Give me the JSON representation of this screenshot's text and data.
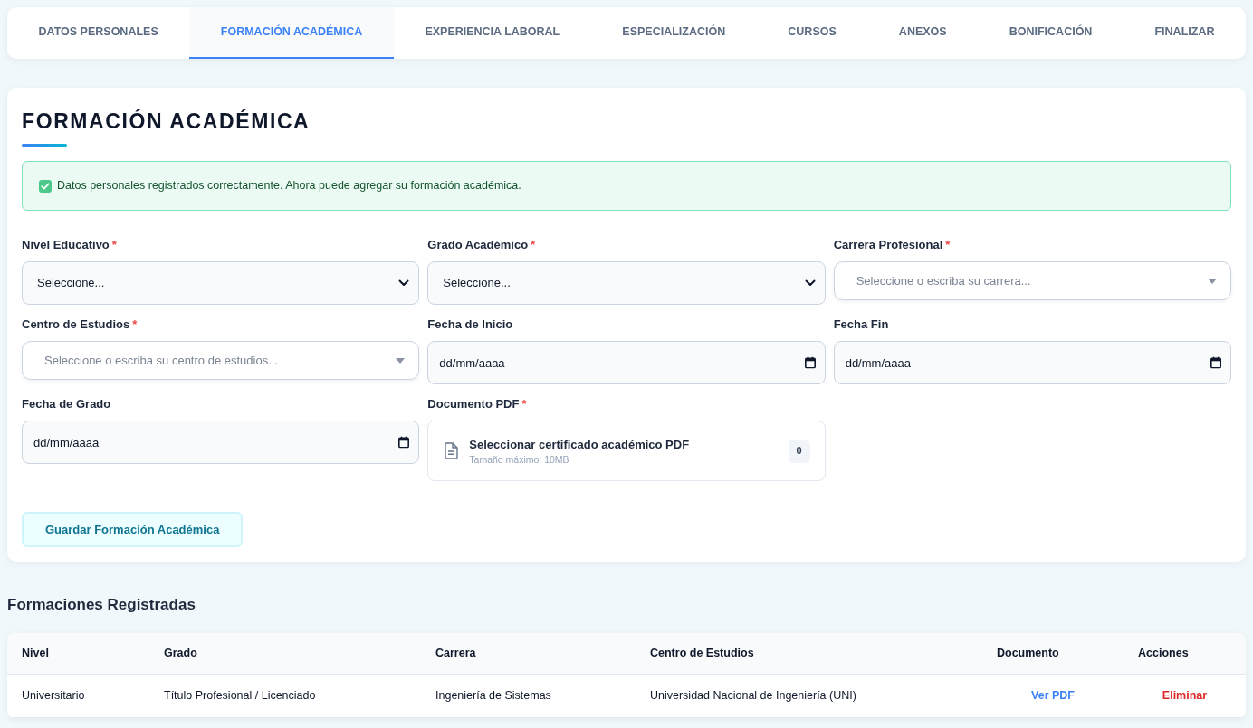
{
  "tabs": [
    {
      "label": "DATOS PERSONALES",
      "selected": false
    },
    {
      "label": "FORMACIÓN ACADÉMICA",
      "selected": true
    },
    {
      "label": "EXPERIENCIA LABORAL",
      "selected": false
    },
    {
      "label": "ESPECIALIZACIÓN",
      "selected": false
    },
    {
      "label": "CURSOS",
      "selected": false
    },
    {
      "label": "ANEXOS",
      "selected": false
    },
    {
      "label": "BONIFICACIÓN",
      "selected": false
    },
    {
      "label": "FINALIZAR",
      "selected": false
    }
  ],
  "form": {
    "title": "FORMACIÓN ACADÉMICA",
    "alert": {
      "kind": "success",
      "text": "Datos personales registrados correctamente. Ahora puede agregar su formación académica."
    },
    "fields": [
      {
        "kind": "select",
        "label": "Nivel Educativo",
        "required_mark": "*",
        "value": "Seleccione..."
      },
      {
        "kind": "select",
        "label": "Grado Académico",
        "required_mark": "*",
        "value": "Seleccione..."
      },
      {
        "kind": "combo",
        "label": "Carrera Profesional",
        "required_mark": "*",
        "placeholder": "Seleccione o escriba su carrera..."
      },
      {
        "kind": "combo",
        "label": "Centro de Estudios",
        "required_mark": "*",
        "placeholder": "Seleccione o escriba su centro de estudios..."
      },
      {
        "kind": "date",
        "label": "Fecha de Inicio",
        "placeholder": "dd/mm/aaaa"
      },
      {
        "kind": "date",
        "label": "Fecha Fin",
        "placeholder": "dd/mm/aaaa"
      },
      {
        "kind": "date",
        "label": "Fecha de Grado",
        "placeholder": "dd/mm/aaaa"
      },
      {
        "kind": "file",
        "label": "Documento PDF",
        "required_mark": "*",
        "text": "Seleccionar certificado académico PDF",
        "hint": "Tamaño máximo: 10MB",
        "count": "0"
      }
    ],
    "submit": "Guardar Formación Académica"
  },
  "registered": {
    "title": "Formaciones Registradas",
    "table": {
      "columns": [
        "Nivel",
        "Grado",
        "Carrera",
        "Centro de Estudios",
        "Documento",
        "Acciones"
      ],
      "rows": [
        {
          "cells": [
            "Universitario",
            "Título Profesional / Licenciado",
            "Ingeniería de Sistemas",
            "Universidad Nacional de Ingeniería (UNI)"
          ],
          "document": "Ver PDF",
          "action": "Eliminar"
        }
      ]
    }
  }
}
